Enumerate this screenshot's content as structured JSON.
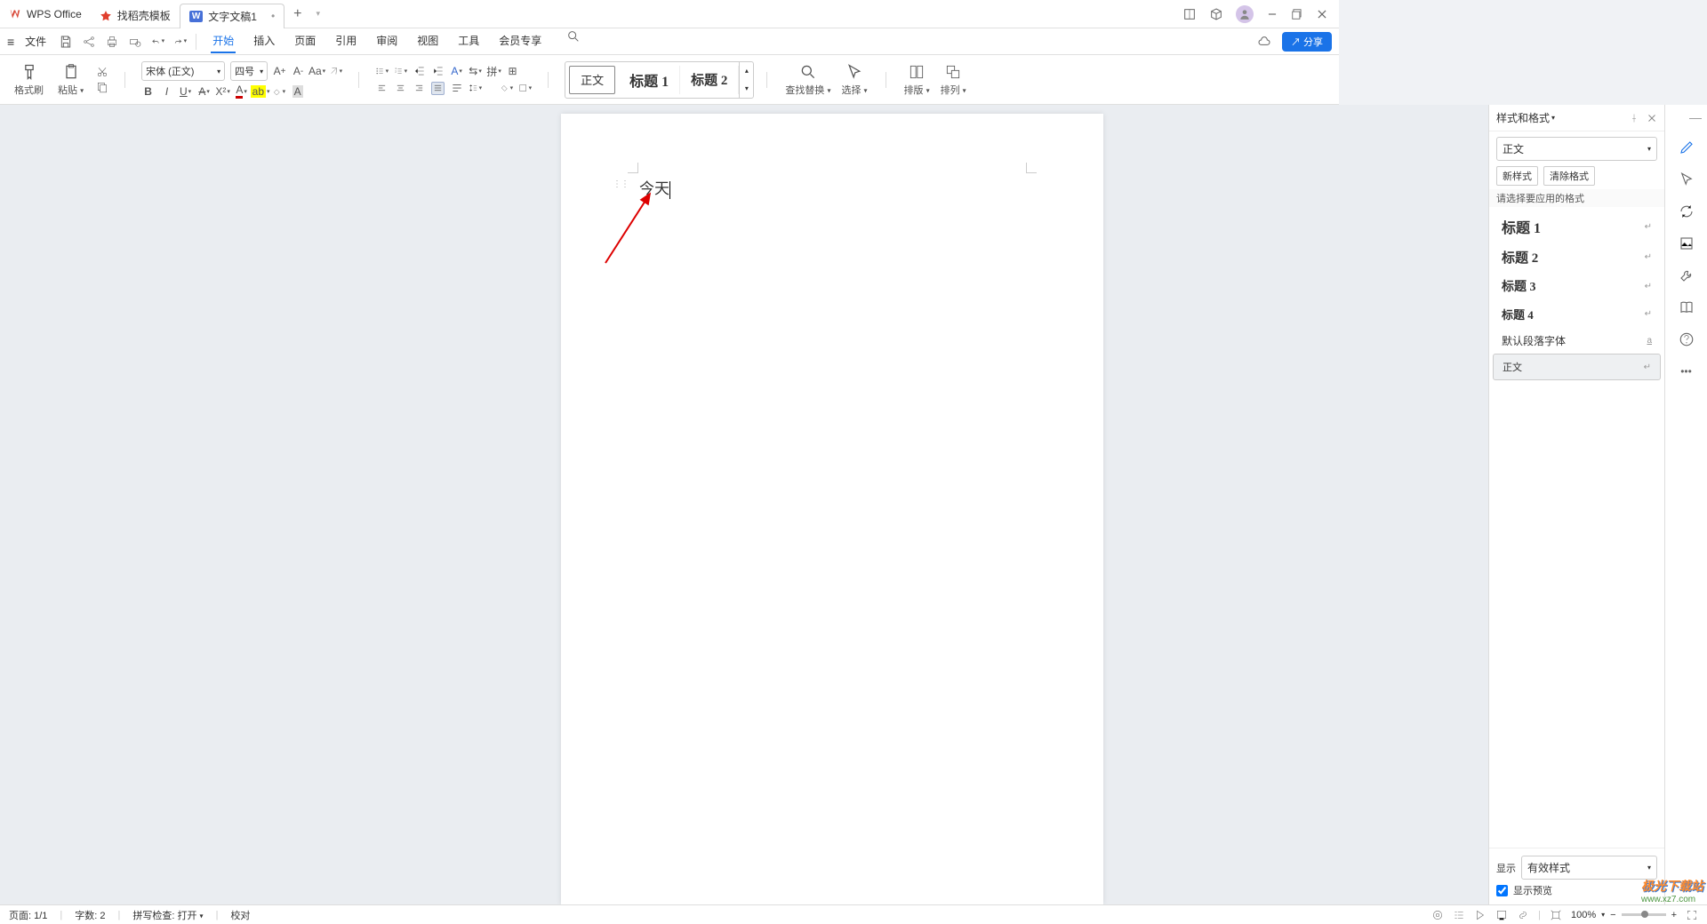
{
  "app": {
    "name": "WPS Office"
  },
  "tabs": [
    {
      "icon": "template",
      "label": "找稻壳模板"
    },
    {
      "icon": "word",
      "label": "文字文稿1",
      "active": true,
      "closeable": true
    }
  ],
  "menu": {
    "file": "文件",
    "tabs": [
      "开始",
      "插入",
      "页面",
      "引用",
      "审阅",
      "视图",
      "工具",
      "会员专享"
    ],
    "active": "开始",
    "share": "分享"
  },
  "ribbon": {
    "format_brush": "格式刷",
    "paste": "粘贴",
    "font": "宋体 (正文)",
    "size": "四号",
    "find_replace": "查找替换",
    "select": "选择",
    "layout": "排版",
    "arrange": "排列",
    "styles": {
      "normal": "正文",
      "h1": "标题 1",
      "h2": "标题 2"
    }
  },
  "doc": {
    "text": "今天"
  },
  "panel": {
    "title": "样式和格式",
    "current": "正文",
    "new_style": "新样式",
    "clear": "清除格式",
    "prompt": "请选择要应用的格式",
    "items": [
      {
        "label": "标题 1",
        "cls": "h1"
      },
      {
        "label": "标题 2",
        "cls": "h2"
      },
      {
        "label": "标题 3",
        "cls": "h3"
      },
      {
        "label": "标题 4",
        "cls": "h4"
      },
      {
        "label": "默认段落字体",
        "cls": "",
        "sym": "a"
      },
      {
        "label": "正文",
        "cls": "",
        "sel": true
      }
    ],
    "show": "显示",
    "show_val": "有效样式",
    "preview": "显示预览"
  },
  "status": {
    "page": "页面: 1/1",
    "words": "字数: 2",
    "spell": "拼写检查: 打开",
    "proof": "校对",
    "zoom": "100%"
  },
  "watermark": {
    "l1": "极光下载站",
    "l2": "www.xz7.com"
  }
}
